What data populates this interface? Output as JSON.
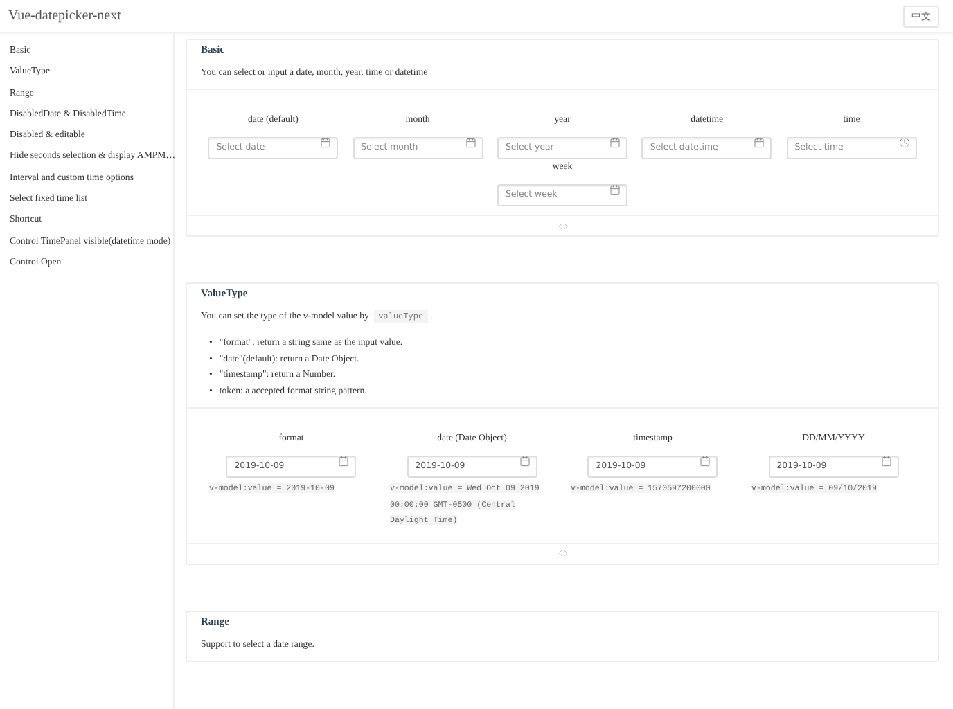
{
  "header": {
    "title": "Vue-datepicker-next",
    "language_button": "中文"
  },
  "sidebar": {
    "items": [
      {
        "label": "Basic"
      },
      {
        "label": "ValueType"
      },
      {
        "label": "Range"
      },
      {
        "label": "DisabledDate & DisabledTime"
      },
      {
        "label": "Disabled & editable"
      },
      {
        "label": "Hide seconds selection & display AMPM…"
      },
      {
        "label": "Interval and custom time options"
      },
      {
        "label": "Select fixed time list"
      },
      {
        "label": "Shortcut"
      },
      {
        "label": "Control TimePanel visible(datetime mode)"
      },
      {
        "label": "Control Open"
      }
    ]
  },
  "sections": [
    {
      "title": "Basic",
      "description": [
        {
          "kind": "text",
          "text": "You can select or input a date, month, year, time or datetime"
        }
      ],
      "pickers": [
        {
          "label": "date (default)",
          "placeholder": "Select date",
          "kind": "date"
        },
        {
          "label": "month",
          "placeholder": "Select month",
          "kind": "date"
        },
        {
          "label": "year",
          "placeholder": "Select year",
          "kind": "date"
        },
        {
          "label": "datetime",
          "placeholder": "Select datetime",
          "kind": "date"
        },
        {
          "label": "time",
          "placeholder": "Select time",
          "kind": "time"
        },
        {
          "label": "week",
          "placeholder": "Select week",
          "kind": "date"
        }
      ]
    },
    {
      "title": "ValueType",
      "description": [
        {
          "kind": "text",
          "text": "You can set the type of the v-model value by "
        },
        {
          "kind": "code",
          "text": "valueType"
        },
        {
          "kind": "text",
          "text": "."
        }
      ],
      "bullets": [
        {
          "marker": "•",
          "text": "\"format\": return a string same as the input value."
        },
        {
          "marker": "•",
          "text": "\"date\"(default): return a Date Object."
        },
        {
          "marker": "•",
          "text": "\"timestamp\": return a Number."
        },
        {
          "marker": "•",
          "text": "token: a accepted format string pattern."
        }
      ],
      "pickers": [
        {
          "label": "format",
          "value": "2019-10-09",
          "kind": "date",
          "output": "v-model:value = 2019-10-09"
        },
        {
          "label": "date (Date Object)",
          "value": "2019-10-09",
          "kind": "date",
          "output": "v-model:value = Wed Oct 09 2019 00:00:00 GMT-0500 (Central Daylight Time)"
        },
        {
          "label": "timestamp",
          "value": "2019-10-09",
          "kind": "date",
          "output": "v-model:value = 1570597200000"
        },
        {
          "label": "DD/MM/YYYY",
          "value": "2019-10-09",
          "kind": "date",
          "output": "v-model:value = 09/10/2019"
        }
      ]
    },
    {
      "title": "Range",
      "description": [
        {
          "kind": "text",
          "text": "Support to select a date range."
        }
      ]
    }
  ]
}
